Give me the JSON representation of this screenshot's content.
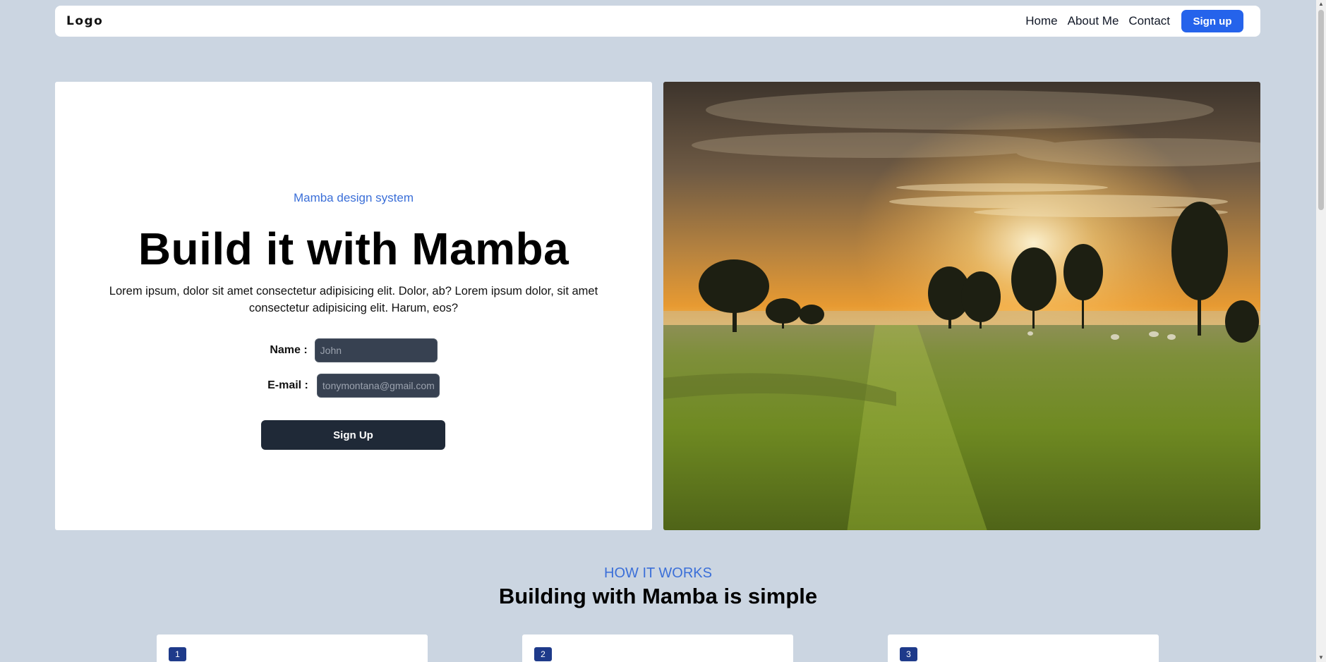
{
  "nav": {
    "logo": "Logo",
    "links": [
      "Home",
      "About Me",
      "Contact"
    ],
    "signup_label": "Sign up"
  },
  "hero": {
    "eyebrow": "Mamba design system",
    "title": "Build it with Mamba",
    "description": "Lorem ipsum, dolor sit amet consectetur adipisicing elit. Dolor, ab? Lorem ipsum dolor, sit amet consectetur adipisicing elit. Harum, eos?",
    "form": {
      "name_label": "Name :",
      "name_placeholder": "John",
      "email_label": "E-mail :",
      "email_placeholder": "tonymontana@gmail.com",
      "submit_label": "Sign Up"
    }
  },
  "how_it_works": {
    "eyebrow": "HOW IT WORKS",
    "title": "Building with Mamba is simple",
    "steps": [
      "1",
      "2",
      "3"
    ]
  },
  "colors": {
    "page_bg": "#cbd5e1",
    "accent": "#2563eb",
    "eyebrow": "#3b6fd8",
    "dark_button": "#1f2937",
    "badge": "#1e3a8a"
  }
}
